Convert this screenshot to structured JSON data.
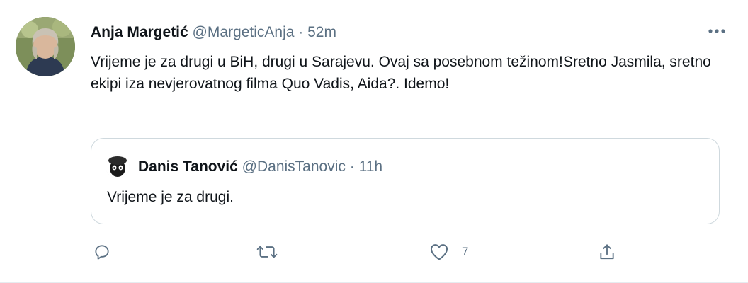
{
  "tweet": {
    "author": {
      "display_name": "Anja Margetić",
      "handle": "@MargeticAnja",
      "separator": "·",
      "time": "52m"
    },
    "text": "Vrijeme je za drugi u BiH, drugi u Sarajevu. Ovaj sa posebnom težinom!Sretno Jasmila, sretno ekipi iza nevjerovatnog filma Quo Vadis, Aida?. Idemo!",
    "quoted": {
      "display_name": "Danis Tanović",
      "handle": "@DanisTanovic",
      "separator": "·",
      "time": "11h",
      "text": "Vrijeme je za drugi."
    },
    "actions": {
      "reply_icon": "reply-icon",
      "retweet_icon": "retweet-icon",
      "like_icon": "heart-icon",
      "like_count": "7",
      "share_icon": "share-icon",
      "more_icon": "more-icon"
    },
    "colors": {
      "text": "#0f1419",
      "secondary": "#5b7083",
      "border": "#cfd9de"
    }
  }
}
